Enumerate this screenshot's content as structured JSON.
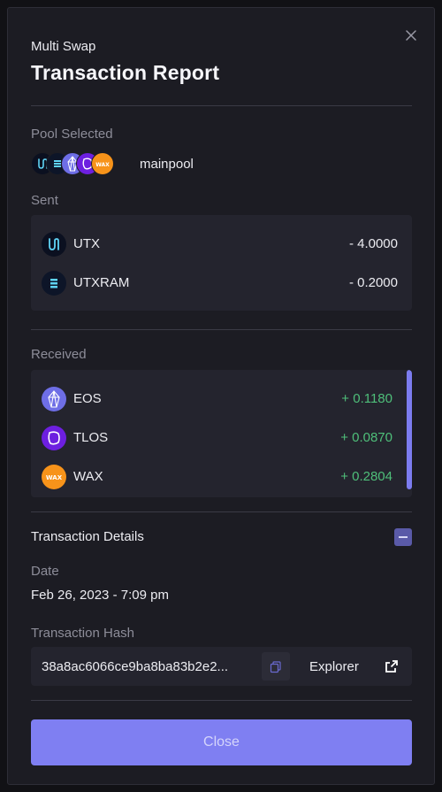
{
  "modal": {
    "close_icon": "close-icon",
    "subtitle": "Multi Swap",
    "title": "Transaction Report"
  },
  "pool": {
    "label": "Pool Selected",
    "name": "mainpool",
    "icons": [
      "utx-icon",
      "utxram-icon",
      "eos-icon",
      "tlos-icon",
      "wax-icon"
    ]
  },
  "sent": {
    "label": "Sent",
    "items": [
      {
        "symbol": "UTX",
        "amount": "- 4.0000",
        "icon": "utx-icon"
      },
      {
        "symbol": "UTXRAM",
        "amount": "- 0.2000",
        "icon": "utxram-icon"
      }
    ]
  },
  "received": {
    "label": "Received",
    "items": [
      {
        "symbol": "EOS",
        "amount": "+ 0.1180",
        "icon": "eos-icon"
      },
      {
        "symbol": "TLOS",
        "amount": "+ 0.0870",
        "icon": "tlos-icon"
      },
      {
        "symbol": "WAX",
        "amount": "+ 0.2804",
        "icon": "wax-icon"
      }
    ]
  },
  "details": {
    "title": "Transaction Details",
    "date_label": "Date",
    "date_value": "Feb 26, 2023 - 7:09 pm",
    "hash_label": "Transaction Hash",
    "hash_value": "38a8ac6066ce9ba8ba83b2e2...",
    "explorer_label": "Explorer"
  },
  "footer": {
    "close_label": "Close"
  },
  "colors": {
    "accent": "#7f7ff2",
    "positive": "#4fbf7a",
    "modal_bg": "#1c1c23",
    "box_bg": "#24242e"
  }
}
